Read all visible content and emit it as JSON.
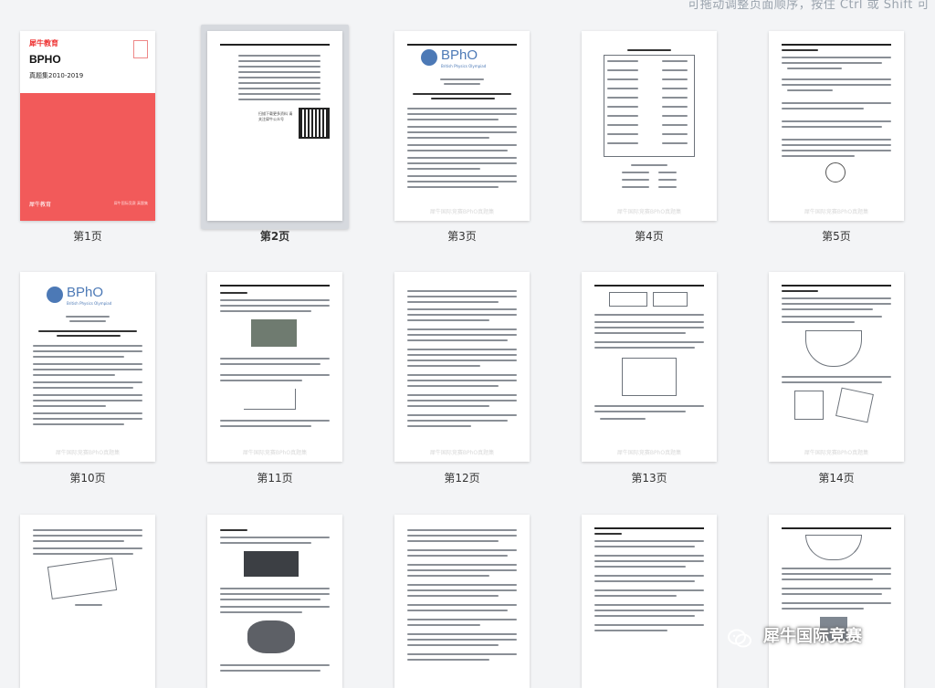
{
  "hint": "可拖动调整页面顺序，按住 Ctrl 或 Shift 可",
  "cover": {
    "brand": "犀牛教育",
    "title": "BPHO",
    "subtitle": "真题集2010-2019",
    "logo": "犀牛教育",
    "footer": "犀牛国际竞赛 真题集"
  },
  "page2": {
    "qr_caption": "扫描下载更多资料 请关注犀牛公众号"
  },
  "bpho_logo": {
    "name": "BPhO",
    "subtitle": "British Physics Olympiad"
  },
  "watermark": "犀牛国际竞赛BPhO真题集",
  "pages": [
    {
      "label": "第1页"
    },
    {
      "label": "第2页"
    },
    {
      "label": "第3页"
    },
    {
      "label": "第4页"
    },
    {
      "label": "第5页"
    },
    {
      "label": "第10页"
    },
    {
      "label": "第11页"
    },
    {
      "label": "第12页"
    },
    {
      "label": "第13页"
    },
    {
      "label": "第14页"
    }
  ],
  "wechat_watermark": "犀牛国际竞赛"
}
